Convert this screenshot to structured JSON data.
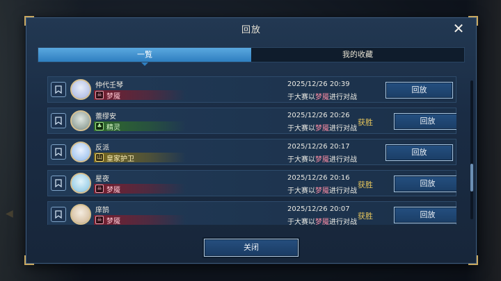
{
  "dialog": {
    "title": "回放",
    "close_icon": "close-icon",
    "close_button_label": "关闭"
  },
  "tabs": [
    {
      "label": "一覧",
      "active": true
    },
    {
      "label": "我的收藏",
      "active": false
    }
  ],
  "colors": {
    "accent": "#2f7fc0",
    "win": "#e6c55c",
    "deck_red": "#7a1e2e",
    "deck_green": "#2f6b2a",
    "deck_yellow": "#7b6a1e"
  },
  "matches": [
    {
      "player": "仲代壬琴",
      "deck": "梦魇",
      "deck_color": "red",
      "deck_icon": "mask-icon",
      "time": "2025/12/26  20:39",
      "desc_prefix": "于大赛以",
      "desc_deck": "梦魇",
      "desc_suffix": "进行对战",
      "result": "",
      "replay_label": "回放"
    },
    {
      "player": "蕾缪安",
      "deck": "精灵",
      "deck_color": "green",
      "deck_icon": "leaf-icon",
      "time": "2025/12/26  20:26",
      "desc_prefix": "于大赛以",
      "desc_deck": "梦魇",
      "desc_suffix": "进行对战",
      "result": "获胜",
      "replay_label": "回放"
    },
    {
      "player": "反派",
      "deck": "皇家护卫",
      "deck_color": "yellow",
      "deck_icon": "mountain-icon",
      "time": "2025/12/26  20:17",
      "desc_prefix": "于大赛以",
      "desc_deck": "梦魇",
      "desc_suffix": "进行对战",
      "result": "",
      "replay_label": "回放"
    },
    {
      "player": "星夜",
      "deck": "梦魇",
      "deck_color": "red",
      "deck_icon": "mask-icon",
      "time": "2025/12/26  20:16",
      "desc_prefix": "于大赛以",
      "desc_deck": "梦魇",
      "desc_suffix": "进行对战",
      "result": "获胜",
      "replay_label": "回放"
    },
    {
      "player": "庠鹄",
      "deck": "梦魇",
      "deck_color": "red",
      "deck_icon": "mask-icon",
      "time": "2025/12/26  20:07",
      "desc_prefix": "于大赛以",
      "desc_deck": "梦魇",
      "desc_suffix": "进行对战",
      "result": "获胜",
      "replay_label": "回放"
    }
  ]
}
